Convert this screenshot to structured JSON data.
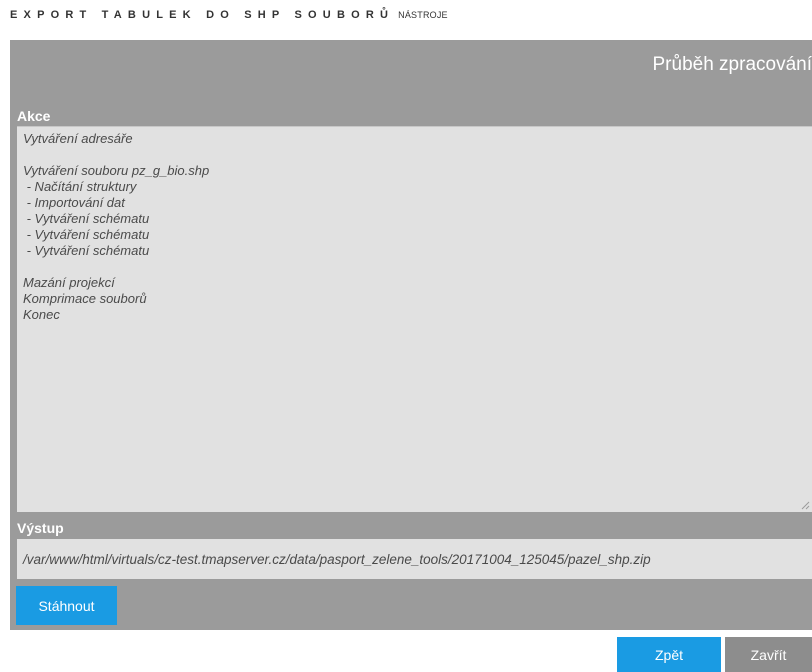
{
  "header": {
    "title": "EXPORT TABULEK DO SHP SOUBORŮ",
    "subtitle": "NÁSTROJE"
  },
  "panel": {
    "title": "Průběh zpracování",
    "actions_label": "Akce",
    "actions_lines": [
      "Vytváření adresáře",
      "",
      "Vytváření souboru pz_g_bio.shp",
      " - Načítání struktury",
      " - Importování dat",
      " - Vytváření schématu",
      " - Vytváření schématu",
      " - Vytváření schématu",
      "",
      "Mazání projekcí",
      "Komprimace souborů",
      "Konec"
    ],
    "output_label": "Výstup",
    "output_path": "/var/www/html/virtuals/cz-test.tmapserver.cz/data/pasport_zelene_tools/20171004_125045/pazel_shp.zip",
    "download_label": "Stáhnout"
  },
  "footer": {
    "back_label": "Zpět",
    "close_label": "Zavřít"
  },
  "colors": {
    "panel_bg": "#9b9b9b",
    "box_bg": "#e1e1e1",
    "button_blue": "#1a9be3",
    "button_gray": "#8d8d8d"
  },
  "icons": {
    "resize": "resize-grip-icon"
  }
}
